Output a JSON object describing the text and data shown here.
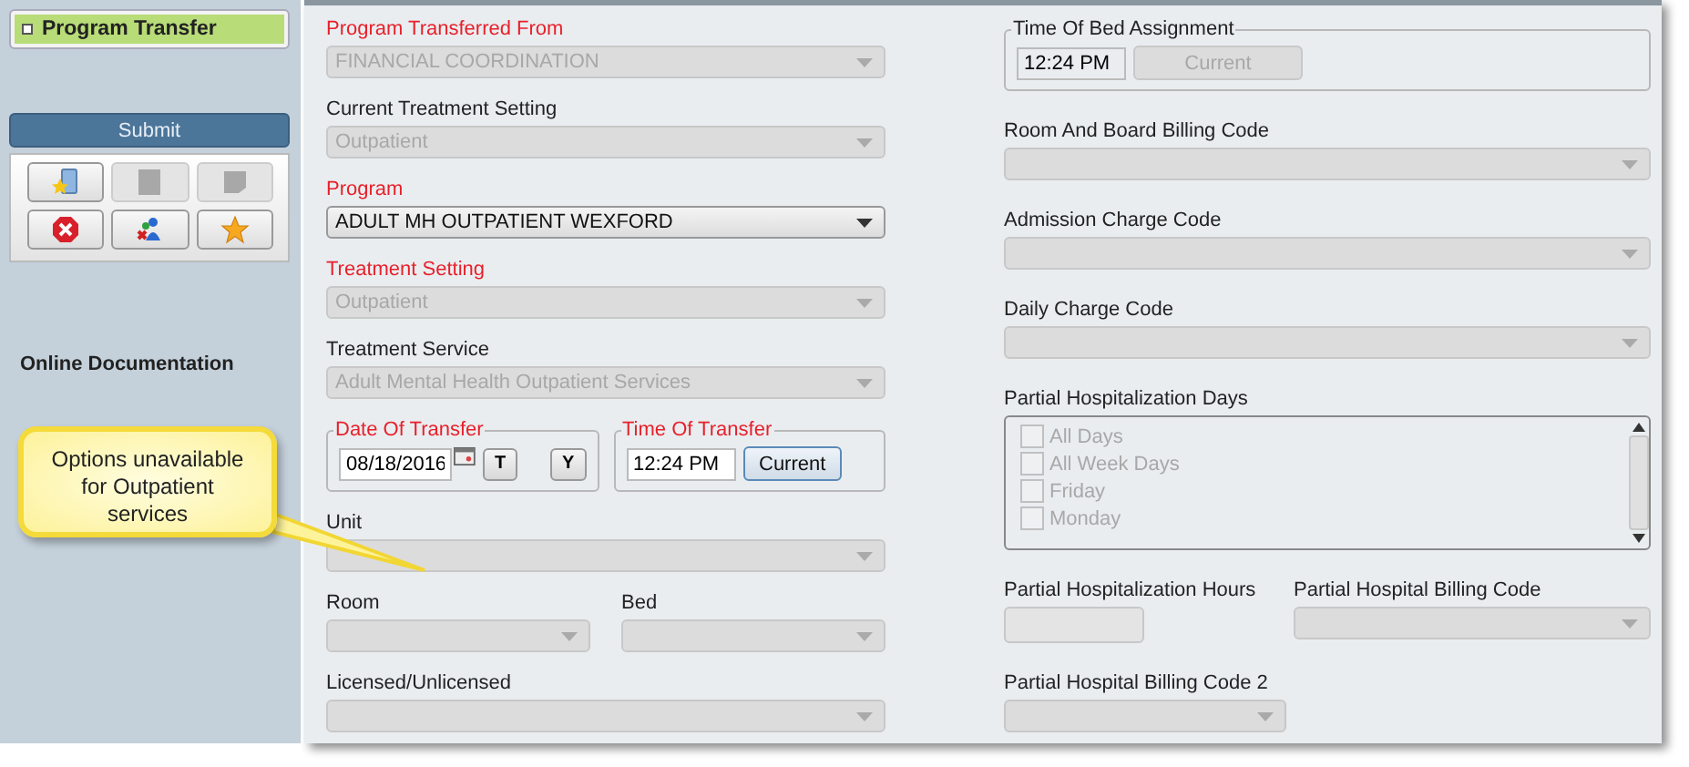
{
  "sidebar": {
    "nav_item": {
      "label": "Program Transfer",
      "selected": true
    },
    "submit": "Submit",
    "toolbar": [
      {
        "kind": "folder-star",
        "disabled": false
      },
      {
        "kind": "page",
        "disabled": true
      },
      {
        "kind": "note",
        "disabled": true
      },
      {
        "kind": "stop",
        "disabled": false
      },
      {
        "kind": "people",
        "disabled": false
      },
      {
        "kind": "star",
        "disabled": false
      }
    ],
    "online_documentation": "Online Documentation"
  },
  "callout": "Options unavailable for Outpatient services",
  "left": [
    {
      "kind": "select",
      "label": "Program Transferred From",
      "required": true,
      "value": "FINANCIAL COORDINATION",
      "disabled": true
    },
    {
      "kind": "select",
      "label": "Current Treatment Setting",
      "required": false,
      "value": "Outpatient",
      "disabled": true
    },
    {
      "kind": "select",
      "label": "Program",
      "required": true,
      "value": "ADULT MH OUTPATIENT WEXFORD",
      "disabled": false
    },
    {
      "kind": "select",
      "label": "Treatment Setting",
      "required": true,
      "value": "Outpatient",
      "disabled": true
    },
    {
      "kind": "select",
      "label": "Treatment Service",
      "required": false,
      "value": "Adult Mental Health Outpatient Services",
      "disabled": true
    },
    {
      "kind": "date_time",
      "date": {
        "legend": "Date Of Transfer",
        "required": true,
        "value": "08/18/2016",
        "buttons": [
          "T",
          "Y"
        ]
      },
      "time": {
        "legend": "Time Of Transfer",
        "required": true,
        "value": "12:24 PM",
        "button": "Current",
        "disabled": false
      }
    },
    {
      "kind": "select",
      "label": "Unit",
      "required": false,
      "disabled": true
    },
    {
      "kind": "pair",
      "items": [
        {
          "kind": "select",
          "label": "Room",
          "disabled": true
        },
        {
          "kind": "select",
          "label": "Bed",
          "disabled": true
        }
      ]
    },
    {
      "kind": "select",
      "label": "Licensed/Unlicensed",
      "required": false,
      "disabled": true
    }
  ],
  "right": [
    {
      "kind": "time",
      "legend": "Time Of Bed Assignment",
      "required": false,
      "value": "12:24 PM",
      "button": "Current",
      "disabled": true
    },
    {
      "kind": "select",
      "label": "Room And Board Billing Code",
      "required": false,
      "disabled": true
    },
    {
      "kind": "select",
      "label": "Admission Charge Code",
      "required": false,
      "disabled": true
    },
    {
      "kind": "select",
      "label": "Daily Charge Code",
      "required": false,
      "disabled": true
    },
    {
      "kind": "listbox",
      "label": "Partial Hospitalization Days",
      "disabled": true,
      "options": [
        {
          "label": "All Days",
          "checked": false
        },
        {
          "label": "All Week Days",
          "checked": false
        },
        {
          "label": "Friday",
          "checked": false
        },
        {
          "label": "Monday",
          "checked": false
        }
      ]
    },
    {
      "kind": "pair",
      "items": [
        {
          "kind": "input",
          "label": "Partial Hospitalization Hours",
          "disabled": true
        },
        {
          "kind": "select",
          "label": "Partial Hospital Billing Code",
          "disabled": true
        }
      ]
    },
    {
      "kind": "select",
      "label": "Partial Hospital Billing Code 2",
      "required": false,
      "disabled": true
    }
  ]
}
